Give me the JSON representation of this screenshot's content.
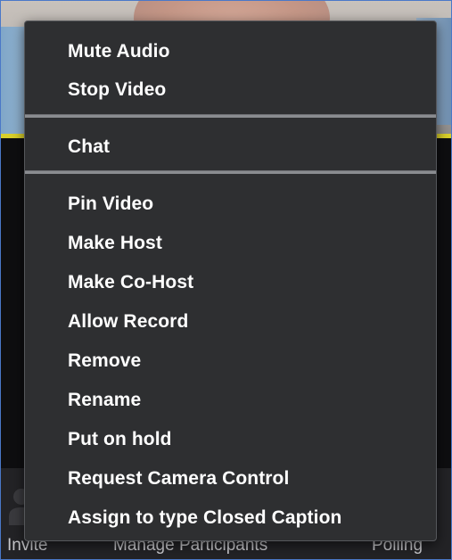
{
  "context_menu": {
    "group_1": [
      {
        "label": "Mute Audio"
      },
      {
        "label": "Stop Video"
      }
    ],
    "group_2": [
      {
        "label": "Chat"
      }
    ],
    "group_3": [
      {
        "label": "Pin Video"
      },
      {
        "label": "Make Host"
      },
      {
        "label": "Make Co-Host"
      },
      {
        "label": "Allow Record"
      },
      {
        "label": "Remove"
      },
      {
        "label": "Rename"
      },
      {
        "label": "Put on hold"
      },
      {
        "label": "Request Camera Control"
      },
      {
        "label": "Assign to type Closed Caption"
      }
    ]
  },
  "toolbar": {
    "invite_label": "Invite",
    "manage_participants_label": "Manage Participants",
    "polling_label": "Polling",
    "invite_icon": "invite-icon",
    "participants_icon": "participants-icon",
    "polling_icon": "polling-icon"
  },
  "colors": {
    "menu_background": "#2e2f31",
    "menu_text": "#ffffff",
    "separator": "#8a8c90",
    "speaker_highlight": "#d9cf2a",
    "toolbar_background": "#232326"
  }
}
